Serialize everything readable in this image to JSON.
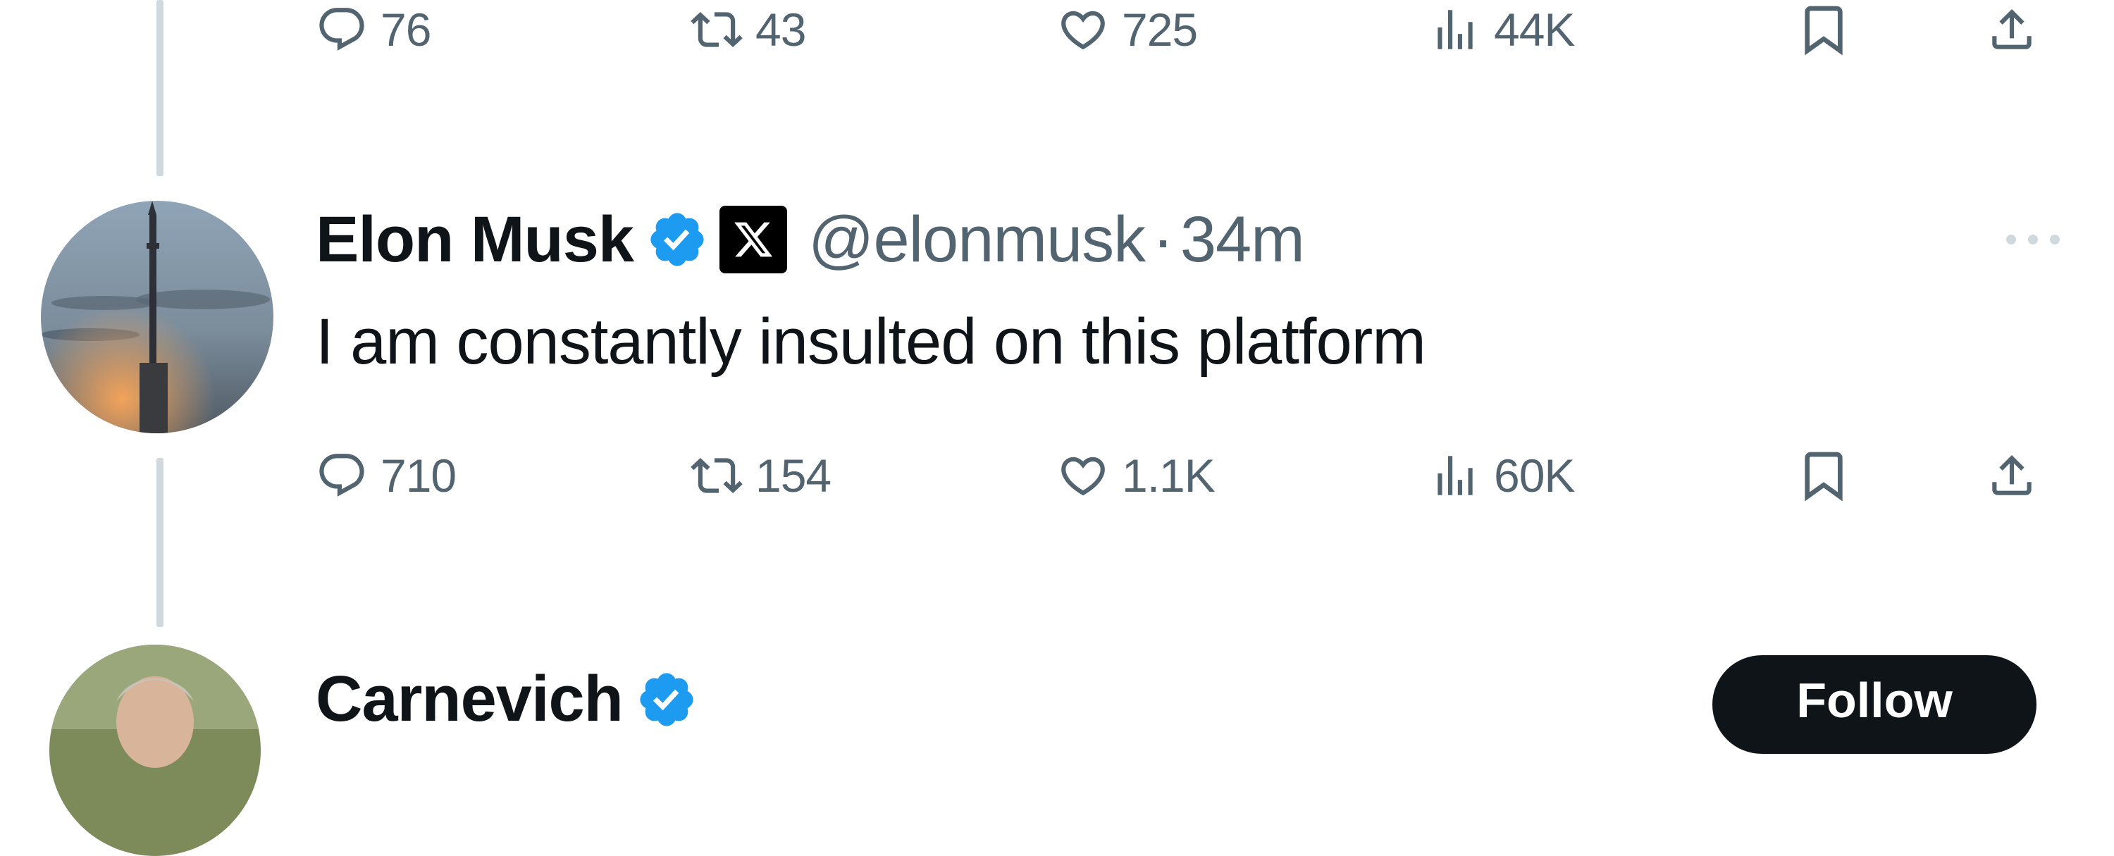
{
  "previous_tweet": {
    "actions": {
      "replies": "76",
      "reposts": "43",
      "likes": "725",
      "views": "44K"
    }
  },
  "main_tweet": {
    "author": {
      "name": "Elon Musk",
      "verified": true,
      "affiliation_badge": "X",
      "handle": "@elonmusk",
      "separator": "·",
      "time": "34m"
    },
    "text": "I am constantly insulted on this platform",
    "actions": {
      "replies": "710",
      "reposts": "154",
      "likes": "1.1K",
      "views": "60K"
    }
  },
  "next_tweet": {
    "author": {
      "name": "Carnevich",
      "verified": true
    },
    "follow_label": "Follow"
  },
  "colors": {
    "text_primary": "#0f1419",
    "text_secondary": "#536471",
    "verified_blue": "#1d9bf0",
    "thread_line": "#cfd9de"
  },
  "icons": [
    "reply-icon",
    "repost-icon",
    "like-icon",
    "views-icon",
    "bookmark-icon",
    "share-icon",
    "more-icon",
    "verified-icon",
    "x-logo-icon"
  ]
}
